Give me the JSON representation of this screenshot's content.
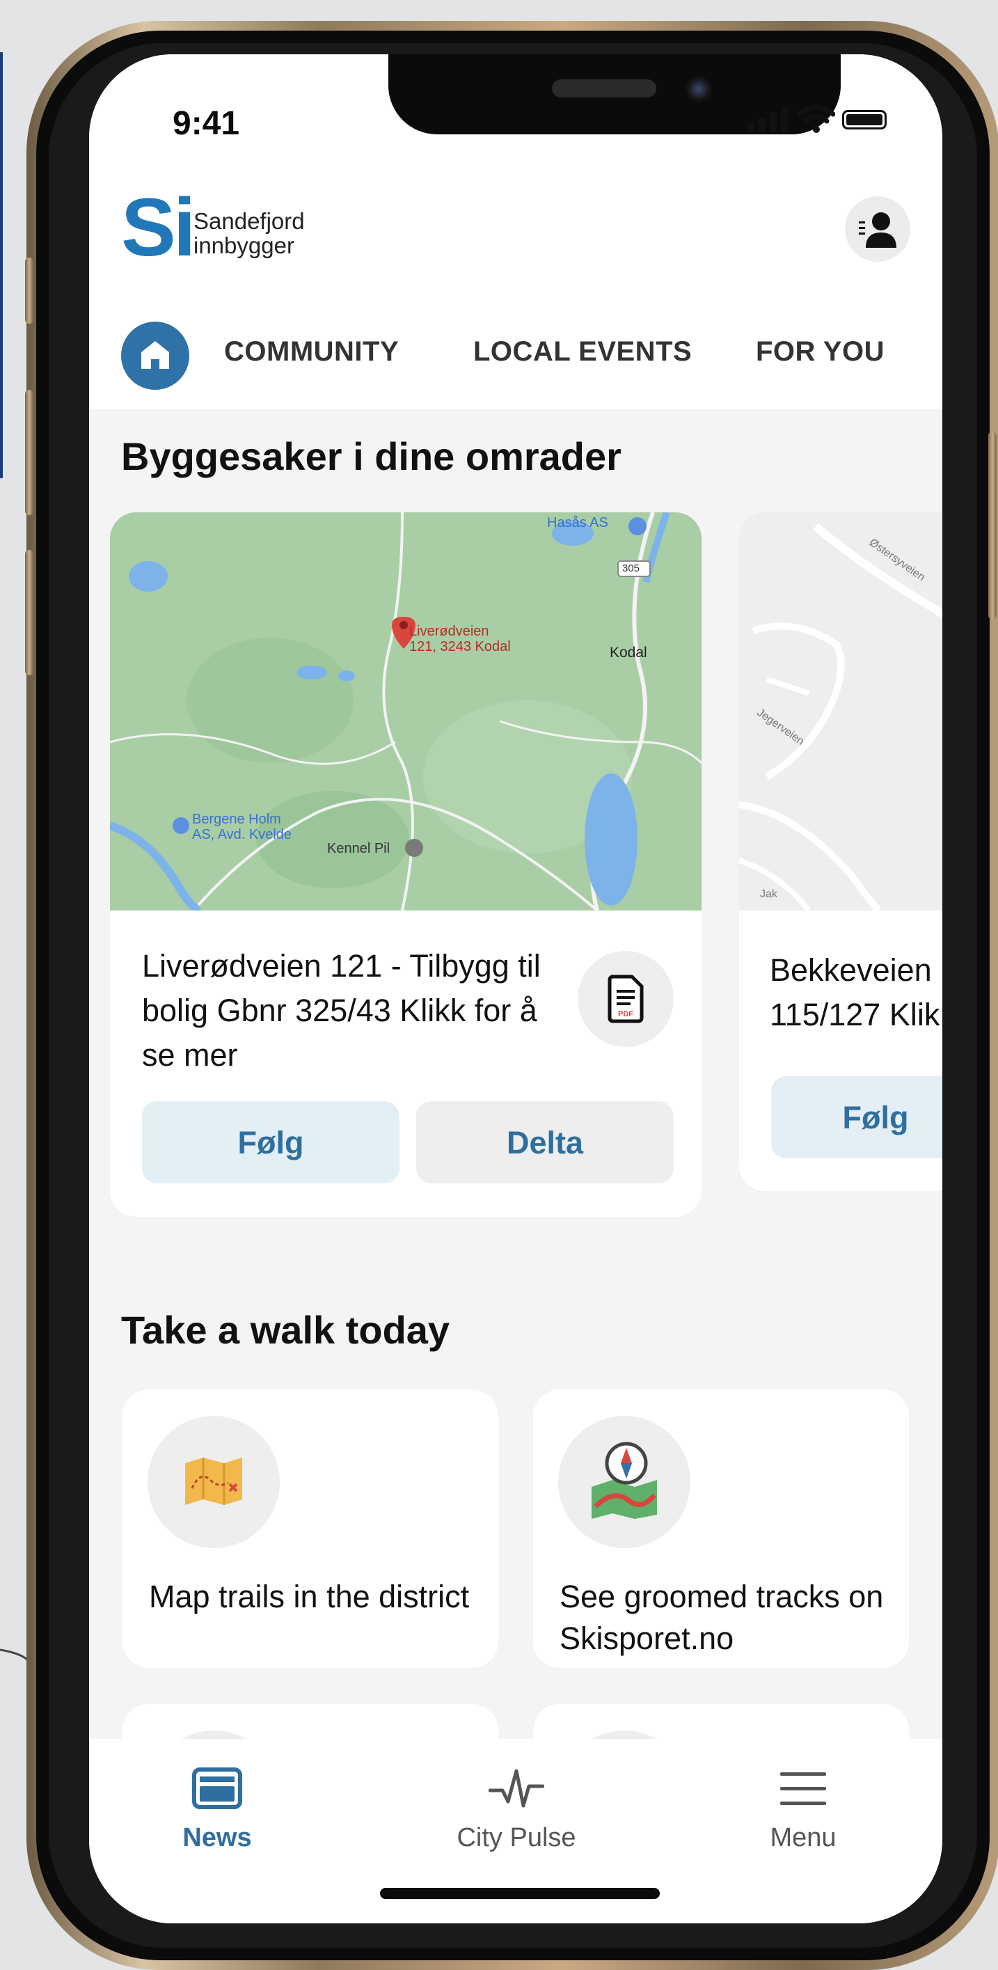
{
  "status_bar": {
    "time": "9:41"
  },
  "header": {
    "logo_mark": "Si",
    "logo_line1": "Sandefjord",
    "logo_line2": "innbygger",
    "profile_icon": "user-icon"
  },
  "tabs": [
    {
      "label": "COMMUNITY"
    },
    {
      "label": "LOCAL EVENTS"
    },
    {
      "label": "FOR YOU"
    }
  ],
  "building_cases": {
    "section_title": "Byggesaker i dine omrader",
    "cards": [
      {
        "title": "Liverødveien 121 - Tilbygg til bolig Gbnr 325/43 Klikk for å se mer",
        "follow_label": "Følg",
        "share_label": "Delta",
        "pdf_icon": "pdf-document-icon",
        "map": {
          "pin_label_1": "Liverødveien",
          "pin_label_2": "121, 3243 Kodal",
          "place_kodal": "Kodal",
          "place_hasas": "Hasås AS",
          "road_305": "305",
          "place_bergene_1": "Bergene Holm",
          "place_bergene_2": "AS, Avd. Kvelde",
          "place_kennel": "Kennel Pil"
        }
      },
      {
        "title_line1": "Bekkeveien",
        "title_line2": "115/127 Klik",
        "follow_label": "Følg",
        "map": {
          "road_a": "Østersyveien",
          "road_b": "Jegerveien",
          "road_c": "Jak"
        }
      }
    ]
  },
  "walk": {
    "section_title": "Take a walk today",
    "items": [
      {
        "label": "Map trails in the district",
        "icon": "trail-map-icon"
      },
      {
        "label": "See groomed tracks on Skisporet.no",
        "icon": "compass-map-icon"
      }
    ]
  },
  "bottom_nav": {
    "items": [
      {
        "label": "News",
        "icon": "news-icon",
        "active": true
      },
      {
        "label": "City Pulse",
        "icon": "pulse-icon",
        "active": false
      },
      {
        "label": "Menu",
        "icon": "menu-icon",
        "active": false
      }
    ],
    "active_color": "#2f6f9f",
    "inactive_color": "#555555"
  },
  "colors": {
    "brand_blue": "#2178b8",
    "button_text": "#2f6f9f",
    "follow_bg": "#e3eff4"
  }
}
